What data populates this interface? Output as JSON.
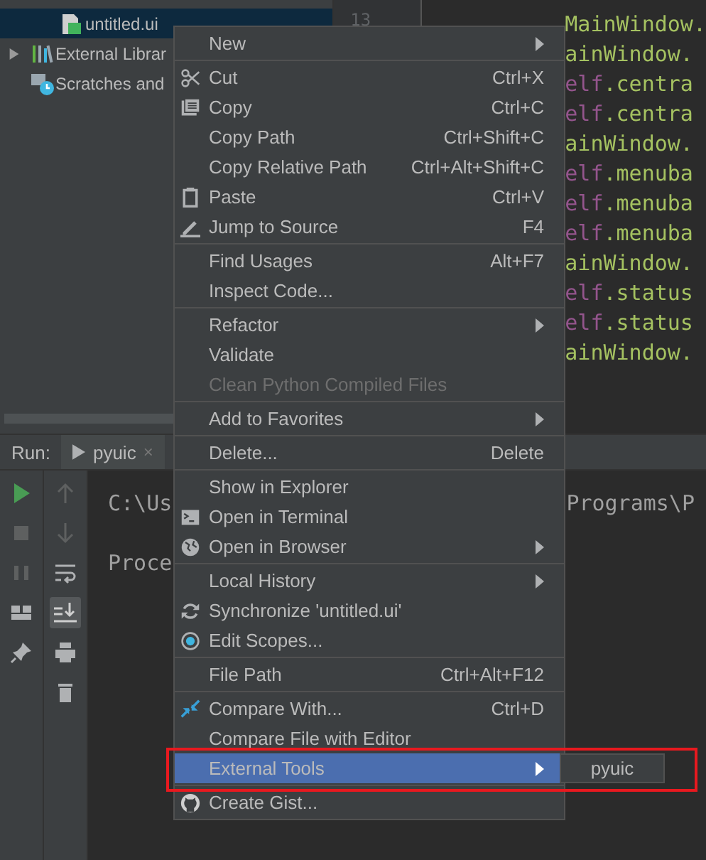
{
  "project_tree": {
    "items": [
      {
        "label": "untitled.ui",
        "kind": "file",
        "selected": true
      },
      {
        "label": "External Librar",
        "kind": "library",
        "selected": false,
        "expanded": false
      },
      {
        "label": "Scratches and",
        "kind": "scratches",
        "selected": false
      }
    ]
  },
  "editor": {
    "line_number": "13",
    "lines": [
      [
        {
          "text": "MainWindow.",
          "kind": "plain"
        }
      ],
      [
        {
          "text": "ainWindow.",
          "kind": "plain"
        }
      ],
      [
        {
          "text": "elf",
          "kind": "self"
        },
        {
          "text": ".centra",
          "kind": "plain"
        }
      ],
      [
        {
          "text": "elf",
          "kind": "self"
        },
        {
          "text": ".centra",
          "kind": "plain"
        }
      ],
      [
        {
          "text": "ainWindow.",
          "kind": "plain"
        }
      ],
      [
        {
          "text": "elf",
          "kind": "self"
        },
        {
          "text": ".menuba",
          "kind": "plain"
        }
      ],
      [
        {
          "text": "elf",
          "kind": "self"
        },
        {
          "text": ".menuba",
          "kind": "plain"
        }
      ],
      [
        {
          "text": "elf",
          "kind": "self"
        },
        {
          "text": ".menuba",
          "kind": "plain"
        }
      ],
      [
        {
          "text": "ainWindow.",
          "kind": "plain"
        }
      ],
      [
        {
          "text": "elf",
          "kind": "self"
        },
        {
          "text": ".status",
          "kind": "plain"
        }
      ],
      [
        {
          "text": "elf",
          "kind": "self"
        },
        {
          "text": ".status",
          "kind": "plain"
        }
      ],
      [
        {
          "text": "ainWindow.",
          "kind": "plain"
        }
      ]
    ]
  },
  "run_panel": {
    "label": "Run:",
    "tab": {
      "label": "pyuic",
      "close": "×"
    },
    "console": [
      {
        "left": "C:\\Us",
        "right": "Programs\\P"
      },
      {
        "left": "Proce"
      }
    ]
  },
  "context_menu": {
    "sections": [
      {
        "items": [
          {
            "label": "New",
            "submenu": true,
            "disabled": false,
            "selected": false
          }
        ]
      },
      {
        "items": [
          {
            "label": "Cut",
            "shortcut": "Ctrl+X",
            "disabled": false,
            "selected": false
          },
          {
            "label": "Copy",
            "shortcut": "Ctrl+C",
            "disabled": false,
            "selected": false
          },
          {
            "label": "Copy Path",
            "shortcut": "Ctrl+Shift+C",
            "disabled": false,
            "selected": false
          },
          {
            "label": "Copy Relative Path",
            "shortcut": "Ctrl+Alt+Shift+C",
            "disabled": false,
            "selected": false
          },
          {
            "label": "Paste",
            "shortcut": "Ctrl+V",
            "disabled": false,
            "selected": false
          },
          {
            "label": "Jump to Source",
            "shortcut": "F4",
            "disabled": false,
            "selected": false
          }
        ]
      },
      {
        "items": [
          {
            "label": "Find Usages",
            "shortcut": "Alt+F7",
            "disabled": false,
            "selected": false
          },
          {
            "label": "Inspect Code...",
            "disabled": false,
            "selected": false
          }
        ]
      },
      {
        "items": [
          {
            "label": "Refactor",
            "submenu": true,
            "disabled": false,
            "selected": false
          },
          {
            "label": "Validate",
            "disabled": false,
            "selected": false
          },
          {
            "label": "Clean Python Compiled Files",
            "disabled": true,
            "selected": false
          }
        ]
      },
      {
        "items": [
          {
            "label": "Add to Favorites",
            "submenu": true,
            "disabled": false,
            "selected": false
          }
        ]
      },
      {
        "items": [
          {
            "label": "Delete...",
            "shortcut": "Delete",
            "disabled": false,
            "selected": false
          }
        ]
      },
      {
        "items": [
          {
            "label": "Show in Explorer",
            "disabled": false,
            "selected": false
          },
          {
            "label": "Open in Terminal",
            "disabled": false,
            "selected": false
          },
          {
            "label": "Open in Browser",
            "submenu": true,
            "disabled": false,
            "selected": false
          }
        ]
      },
      {
        "items": [
          {
            "label": "Local History",
            "submenu": true,
            "disabled": false,
            "selected": false
          },
          {
            "label": "Synchronize 'untitled.ui'",
            "disabled": false,
            "selected": false
          },
          {
            "label": "Edit Scopes...",
            "disabled": false,
            "selected": false
          }
        ]
      },
      {
        "items": [
          {
            "label": "File Path",
            "shortcut": "Ctrl+Alt+F12",
            "disabled": false,
            "selected": false
          }
        ]
      },
      {
        "items": [
          {
            "label": "Compare With...",
            "shortcut": "Ctrl+D",
            "disabled": false,
            "selected": false
          },
          {
            "label": "Compare File with Editor",
            "disabled": false,
            "selected": false
          },
          {
            "label": "External Tools",
            "submenu": true,
            "disabled": false,
            "selected": true,
            "highlighted": true,
            "submenu_items": [
              {
                "label": "pyuic"
              }
            ]
          }
        ]
      },
      {
        "items": [
          {
            "label": "Create Gist...",
            "disabled": false,
            "selected": false
          }
        ]
      }
    ]
  }
}
